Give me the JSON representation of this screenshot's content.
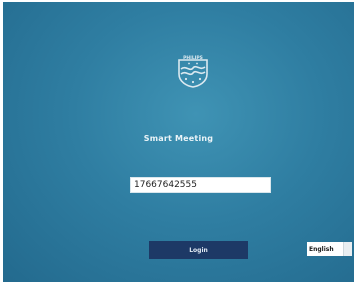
{
  "app": {
    "title": "Smart Meeting",
    "brand_text": "PHILIPS"
  },
  "login_form": {
    "phone_value": "17667642555",
    "login_label": "Login"
  },
  "language": {
    "selected": "English"
  },
  "colors": {
    "background": "#2f7ea2",
    "login_button": "#1d3966",
    "logo": "#dbe9f0"
  },
  "icons": {
    "logo": "philips-shield-logo-icon",
    "language_dropdown": "dropdown-arrow-icon"
  }
}
